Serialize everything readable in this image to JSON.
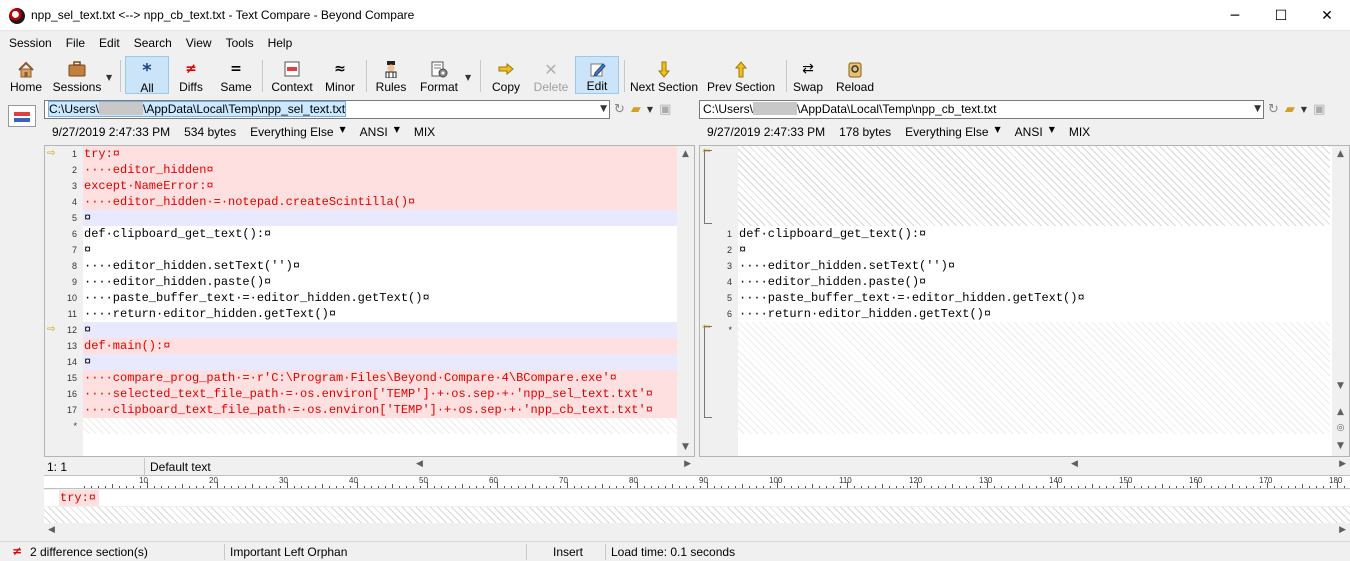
{
  "window": {
    "title": "npp_sel_text.txt <--> npp_cb_text.txt - Text Compare - Beyond Compare",
    "minimize": "─",
    "maximize": "☐",
    "close": "✕"
  },
  "menu": [
    "Session",
    "File",
    "Edit",
    "Search",
    "View",
    "Tools",
    "Help"
  ],
  "toolbar": {
    "home": "Home",
    "sessions": "Sessions",
    "all": "All",
    "diffs": "Diffs",
    "same": "Same",
    "context": "Context",
    "minor": "Minor",
    "rules": "Rules",
    "format": "Format",
    "copy": "Copy",
    "delete": "Delete",
    "edit": "Edit",
    "next_section": "Next Section",
    "prev_section": "Prev Section",
    "swap": "Swap",
    "reload": "Reload"
  },
  "left": {
    "path_prefix": "C:\\Users\\",
    "path_suffix": "\\AppData\\Local\\Temp\\npp_sel_text.txt",
    "date": "9/27/2019 2:47:33 PM",
    "size": "534 bytes",
    "format": "Everything Else",
    "encoding": "ANSI",
    "line_endings": "MIX",
    "position": "1: 1",
    "text_format": "Default text",
    "lines": [
      {
        "n": "1",
        "t": "try:¤",
        "k": "diff",
        "arrow": true
      },
      {
        "n": "2",
        "t": "····editor_hidden¤",
        "k": "diff"
      },
      {
        "n": "3",
        "t": "except·NameError:¤",
        "k": "diff"
      },
      {
        "n": "4",
        "t": "····editor_hidden·=·notepad.createScintilla()¤",
        "k": "diff"
      },
      {
        "n": "5",
        "t": "¤",
        "k": "blankdiff"
      },
      {
        "n": "6",
        "t": "def·clipboard_get_text():¤",
        "k": "same"
      },
      {
        "n": "7",
        "t": "¤",
        "k": "same"
      },
      {
        "n": "8",
        "t": "····editor_hidden.setText('')¤",
        "k": "same"
      },
      {
        "n": "9",
        "t": "····editor_hidden.paste()¤",
        "k": "same"
      },
      {
        "n": "10",
        "t": "····paste_buffer_text·=·editor_hidden.getText()¤",
        "k": "same"
      },
      {
        "n": "11",
        "t": "····return·editor_hidden.getText()¤",
        "k": "same"
      },
      {
        "n": "12",
        "t": "¤",
        "k": "blankdiff",
        "arrow": true
      },
      {
        "n": "13",
        "t": "def·main():¤",
        "k": "diff"
      },
      {
        "n": "14",
        "t": "¤",
        "k": "blankdiff"
      },
      {
        "n": "15",
        "t": "····compare_prog_path·=·r'C:\\Program·Files\\Beyond·Compare·4\\BCompare.exe'¤",
        "k": "diff"
      },
      {
        "n": "16",
        "t": "····selected_text_file_path·=·os.environ['TEMP']·+·os.sep·+·'npp_sel_text.txt'¤",
        "k": "diff"
      },
      {
        "n": "17",
        "t": "····clipboard_text_file_path·=·os.environ['TEMP']·+·os.sep·+·'npp_cb_text.txt'¤",
        "k": "diff"
      },
      {
        "n": "*",
        "t": "",
        "k": "eof"
      }
    ]
  },
  "right": {
    "path_prefix": "C:\\Users\\",
    "path_suffix": "\\AppData\\Local\\Temp\\npp_cb_text.txt",
    "date": "9/27/2019 2:47:33 PM",
    "size": "178 bytes",
    "format": "Everything Else",
    "encoding": "ANSI",
    "line_endings": "MIX",
    "lines": [
      {
        "n": "1",
        "t": "def·clipboard_get_text():¤"
      },
      {
        "n": "2",
        "t": "¤"
      },
      {
        "n": "3",
        "t": "····editor_hidden.setText('')¤"
      },
      {
        "n": "4",
        "t": "····editor_hidden.paste()¤"
      },
      {
        "n": "5",
        "t": "····paste_buffer_text·=·editor_hidden.getText()¤"
      },
      {
        "n": "6",
        "t": "····return·editor_hidden.getText()¤"
      },
      {
        "n": "*",
        "t": ""
      }
    ]
  },
  "ruler_labels": [
    "10",
    "20",
    "30",
    "40",
    "50",
    "60",
    "70",
    "80",
    "90",
    "100",
    "110",
    "120",
    "130",
    "140",
    "150",
    "160",
    "170",
    "180"
  ],
  "line_view": {
    "top": "try:¤",
    "bottom": ""
  },
  "status": {
    "differences": "2 difference section(s)",
    "orphan": "Important Left Orphan",
    "mode": "Insert",
    "load_time": "Load time: 0.1 seconds"
  },
  "icons": {
    "diff_arrow": "⇨",
    "left_arrow": "⇦",
    "not_equal": "≠"
  }
}
